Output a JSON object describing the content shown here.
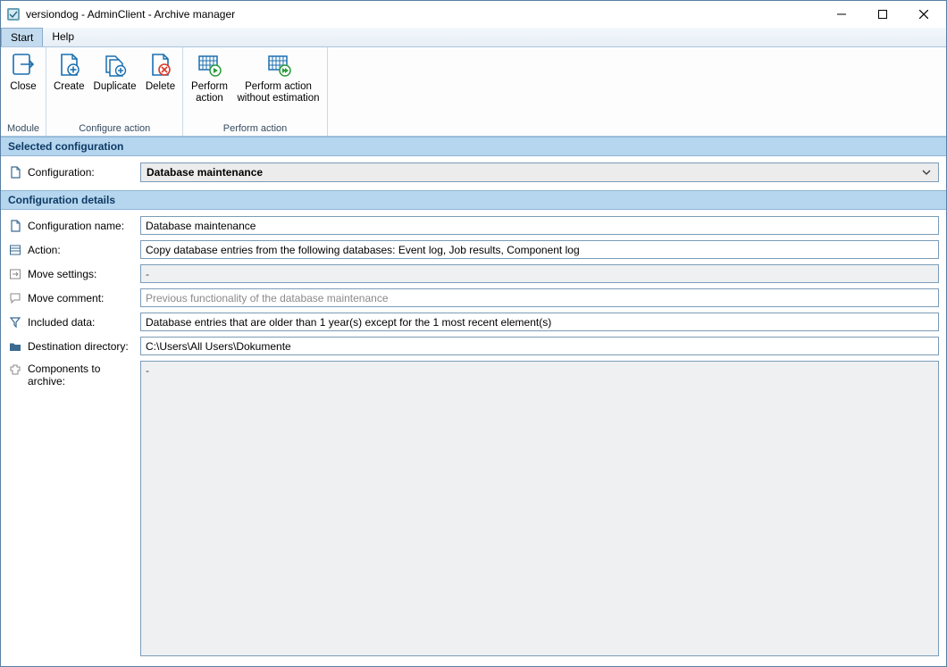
{
  "window": {
    "title": "versiondog - AdminClient - Archive manager"
  },
  "menubar": {
    "items": [
      {
        "label": "Start",
        "active": true
      },
      {
        "label": "Help",
        "active": false
      }
    ]
  },
  "ribbon": {
    "groups": [
      {
        "label": "Module",
        "buttons": [
          {
            "name": "close-button",
            "label": "Close",
            "icon": "close-module-icon"
          }
        ]
      },
      {
        "label": "Configure action",
        "buttons": [
          {
            "name": "create-button",
            "label": "Create",
            "icon": "doc-plus-icon"
          },
          {
            "name": "duplicate-button",
            "label": "Duplicate",
            "icon": "doc-dup-icon"
          },
          {
            "name": "delete-button",
            "label": "Delete",
            "icon": "doc-delete-icon"
          }
        ]
      },
      {
        "label": "Perform action",
        "buttons": [
          {
            "name": "perform-action-button",
            "label": "Perform\naction",
            "icon": "perform-icon"
          },
          {
            "name": "perform-no-estimation-button",
            "label": "Perform action\nwithout estimation",
            "icon": "perform-noest-icon"
          }
        ]
      }
    ]
  },
  "selected_configuration": {
    "header": "Selected configuration",
    "label": "Configuration:",
    "value": "Database maintenance"
  },
  "configuration_details": {
    "header": "Configuration details",
    "rows": {
      "name": {
        "label": "Configuration name:",
        "value": "Database maintenance"
      },
      "action": {
        "label": "Action:",
        "value": "Copy database entries from the following databases: Event log, Job results, Component log"
      },
      "move": {
        "label": "Move settings:",
        "value": "-"
      },
      "comment": {
        "label": "Move comment:",
        "value": "Previous functionality of the database maintenance"
      },
      "included": {
        "label": "Included data:",
        "value": "Database entries that are older than 1 year(s) except for the 1 most recent element(s)"
      },
      "dest": {
        "label": "Destination directory:",
        "value": "C:\\Users\\All Users\\Dokumente"
      },
      "components": {
        "label": "Components to archive:",
        "value": "-"
      }
    }
  }
}
